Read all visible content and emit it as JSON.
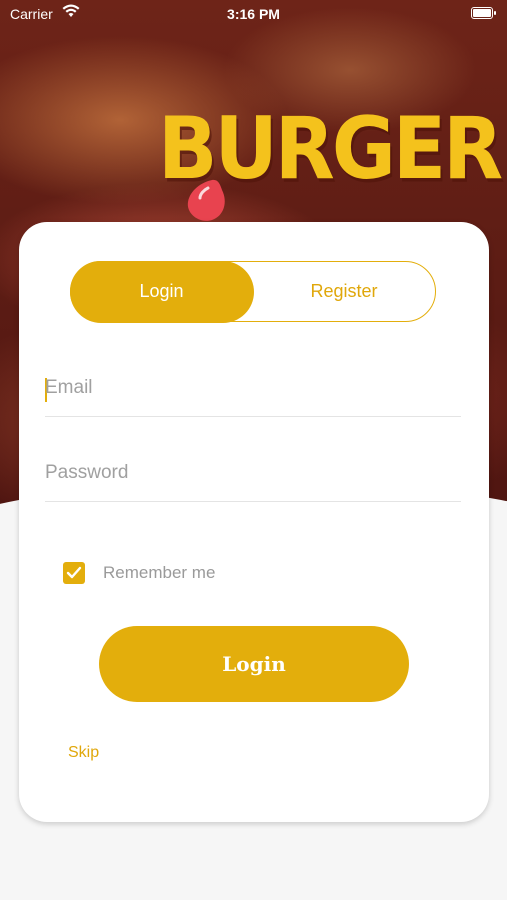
{
  "status_bar": {
    "carrier": "Carrier",
    "time": "3:16 PM",
    "icons": [
      "wifi-icon",
      "battery-icon"
    ]
  },
  "brand": {
    "logo_text": "BURGER",
    "accent_color": "#e3ae0c",
    "logo_color": "#f4c21c"
  },
  "tabs": {
    "login_label": "Login",
    "register_label": "Register",
    "selected": "Login"
  },
  "form": {
    "email_placeholder": "Email",
    "email_value": "",
    "password_placeholder": "Password",
    "password_value": "",
    "remember_label": "Remember me",
    "remember_checked": true,
    "submit_label": "Login",
    "skip_label": "Skip"
  }
}
